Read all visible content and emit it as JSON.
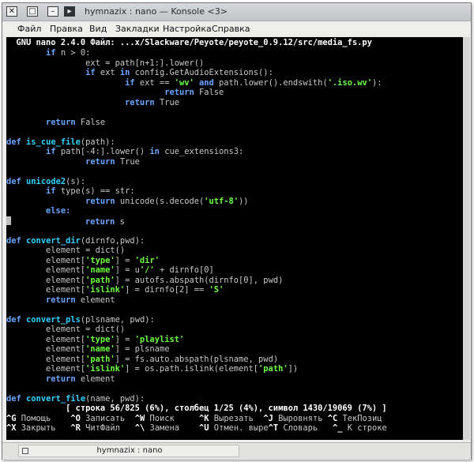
{
  "window": {
    "title": "hymnazix : nano — Konsole <3>",
    "buttons": {
      "close": "✕",
      "maximize": "□",
      "minimize": "–",
      "menu": "▸"
    }
  },
  "menubar": [
    "Файл",
    "Правка",
    "Вид",
    "Закладки",
    "Настройка",
    "Справка"
  ],
  "editor": {
    "header": "  GNU nano 2.4.0 Файл: ...x/Slackware/Peyote/peyote_0.9.12/src/media_fs.py",
    "lines": [
      [
        [
          "        ",
          ""
        ],
        [
          "if",
          "kw"
        ],
        [
          " n > 0:",
          ""
        ]
      ],
      [
        [
          "                ext = path[n+1:].lower()",
          ""
        ]
      ],
      [
        [
          "                ",
          ""
        ],
        [
          "if",
          "kw"
        ],
        [
          " ext ",
          ""
        ],
        [
          "in",
          "kw"
        ],
        [
          " config.GetAudioExtensions():",
          ""
        ]
      ],
      [
        [
          "                        ",
          ""
        ],
        [
          "if",
          "kw"
        ],
        [
          " ext == ",
          ""
        ],
        [
          "'wv'",
          "st"
        ],
        [
          " ",
          ""
        ],
        [
          "and",
          "kw"
        ],
        [
          " path.lower().endswith(",
          ""
        ],
        [
          "'.iso.wv'",
          "st"
        ],
        [
          "):",
          ""
        ]
      ],
      [
        [
          "                                ",
          ""
        ],
        [
          "return",
          "kw"
        ],
        [
          " False",
          ""
        ]
      ],
      [
        [
          "                        ",
          ""
        ],
        [
          "return",
          "kw"
        ],
        [
          " True",
          ""
        ]
      ],
      [
        [
          "",
          ""
        ]
      ],
      [
        [
          "        ",
          ""
        ],
        [
          "return",
          "kw"
        ],
        [
          " False",
          ""
        ]
      ],
      [
        [
          "",
          ""
        ]
      ],
      [
        [
          "def",
          "kw"
        ],
        [
          " ",
          ""
        ],
        [
          "is_cue_file",
          "fn"
        ],
        [
          "(path):",
          ""
        ]
      ],
      [
        [
          "        ",
          ""
        ],
        [
          "if",
          "kw"
        ],
        [
          " path[-4:].lower() ",
          ""
        ],
        [
          "in",
          "kw"
        ],
        [
          " cue_extensions3:",
          ""
        ]
      ],
      [
        [
          "                ",
          ""
        ],
        [
          "return",
          "kw"
        ],
        [
          " True",
          ""
        ]
      ],
      [
        [
          "",
          ""
        ]
      ],
      [
        [
          "def",
          "kw"
        ],
        [
          " ",
          ""
        ],
        [
          "unicode2",
          "fn"
        ],
        [
          "(s):",
          ""
        ]
      ],
      [
        [
          "        ",
          ""
        ],
        [
          "if",
          "kw"
        ],
        [
          " type(s) == str:",
          ""
        ]
      ],
      [
        [
          "                ",
          ""
        ],
        [
          "return",
          "kw"
        ],
        [
          " unicode(s.decode(",
          ""
        ],
        [
          "'utf-8'",
          "st"
        ],
        [
          "))",
          ""
        ]
      ],
      [
        [
          "        ",
          ""
        ],
        [
          "else:",
          "kw"
        ]
      ],
      [
        [
          "",
          "cursor"
        ],
        [
          "               ",
          ""
        ],
        [
          "return",
          "kw"
        ],
        [
          " s",
          ""
        ]
      ],
      [
        [
          "",
          ""
        ]
      ],
      [
        [
          "def",
          "kw"
        ],
        [
          " ",
          ""
        ],
        [
          "convert_dir",
          "fn"
        ],
        [
          "(dirnfo,pwd):",
          ""
        ]
      ],
      [
        [
          "        element = dict()",
          ""
        ]
      ],
      [
        [
          "        element[",
          ""
        ],
        [
          "'type'",
          "st"
        ],
        [
          "] = ",
          ""
        ],
        [
          "'dir'",
          "st"
        ]
      ],
      [
        [
          "        element[",
          ""
        ],
        [
          "'name'",
          "st"
        ],
        [
          "] = u",
          ""
        ],
        [
          "'/'",
          "st"
        ],
        [
          " + dirnfo[0]",
          ""
        ]
      ],
      [
        [
          "        element[",
          ""
        ],
        [
          "'path'",
          "st"
        ],
        [
          "] = autofs.abspath(dirnfo[0], pwd)",
          ""
        ]
      ],
      [
        [
          "        element[",
          ""
        ],
        [
          "'islink'",
          "st"
        ],
        [
          "] = dirnfo[2] == ",
          ""
        ],
        [
          "'S'",
          "st"
        ]
      ],
      [
        [
          "        ",
          ""
        ],
        [
          "return",
          "kw"
        ],
        [
          " element",
          ""
        ]
      ],
      [
        [
          "",
          ""
        ]
      ],
      [
        [
          "def",
          "kw"
        ],
        [
          " ",
          ""
        ],
        [
          "convert_pls",
          "fn"
        ],
        [
          "(plsname, pwd):",
          ""
        ]
      ],
      [
        [
          "        element = dict()",
          ""
        ]
      ],
      [
        [
          "        element[",
          ""
        ],
        [
          "'type'",
          "st"
        ],
        [
          "] = ",
          ""
        ],
        [
          "'playlist'",
          "st"
        ]
      ],
      [
        [
          "        element[",
          ""
        ],
        [
          "'name'",
          "st"
        ],
        [
          "] = plsname",
          ""
        ]
      ],
      [
        [
          "        element[",
          ""
        ],
        [
          "'path'",
          "st"
        ],
        [
          "] = fs.auto.abspath(plsname, pwd)",
          ""
        ]
      ],
      [
        [
          "        element[",
          ""
        ],
        [
          "'islink'",
          "st"
        ],
        [
          "] = os.path.islink(element[",
          ""
        ],
        [
          "'path'",
          "st"
        ],
        [
          "])",
          ""
        ]
      ],
      [
        [
          "        ",
          ""
        ],
        [
          "return",
          "kw"
        ],
        [
          " element",
          ""
        ]
      ],
      [
        [
          "",
          ""
        ]
      ],
      [
        [
          "def",
          "kw"
        ],
        [
          " ",
          ""
        ],
        [
          "convert_file",
          "fn"
        ],
        [
          "(name, pwd):",
          ""
        ]
      ]
    ],
    "status": "            [ строка 56/825 (6%), столбец 1/25 (4%), символ 1430/19069 (7%) ]",
    "shortcuts_row1": [
      [
        "^G",
        " Помощь    "
      ],
      [
        "^O",
        " Записать  "
      ],
      [
        "^W",
        " Поиск     "
      ],
      [
        "^K",
        " Вырезать  "
      ],
      [
        "^J",
        " Выровнять "
      ],
      [
        "^C",
        " ТекПозиц"
      ]
    ],
    "shortcuts_row2": [
      [
        "^X",
        " Закрыть   "
      ],
      [
        "^R",
        " ЧитФайл   "
      ],
      [
        "^\\",
        " Замена    "
      ],
      [
        "^U",
        " Отмен. выре"
      ],
      [
        "^T",
        " Словарь   "
      ],
      [
        "^_",
        " К строке"
      ]
    ]
  },
  "taskbar": {
    "tab_label": "hymnazix : nano"
  }
}
